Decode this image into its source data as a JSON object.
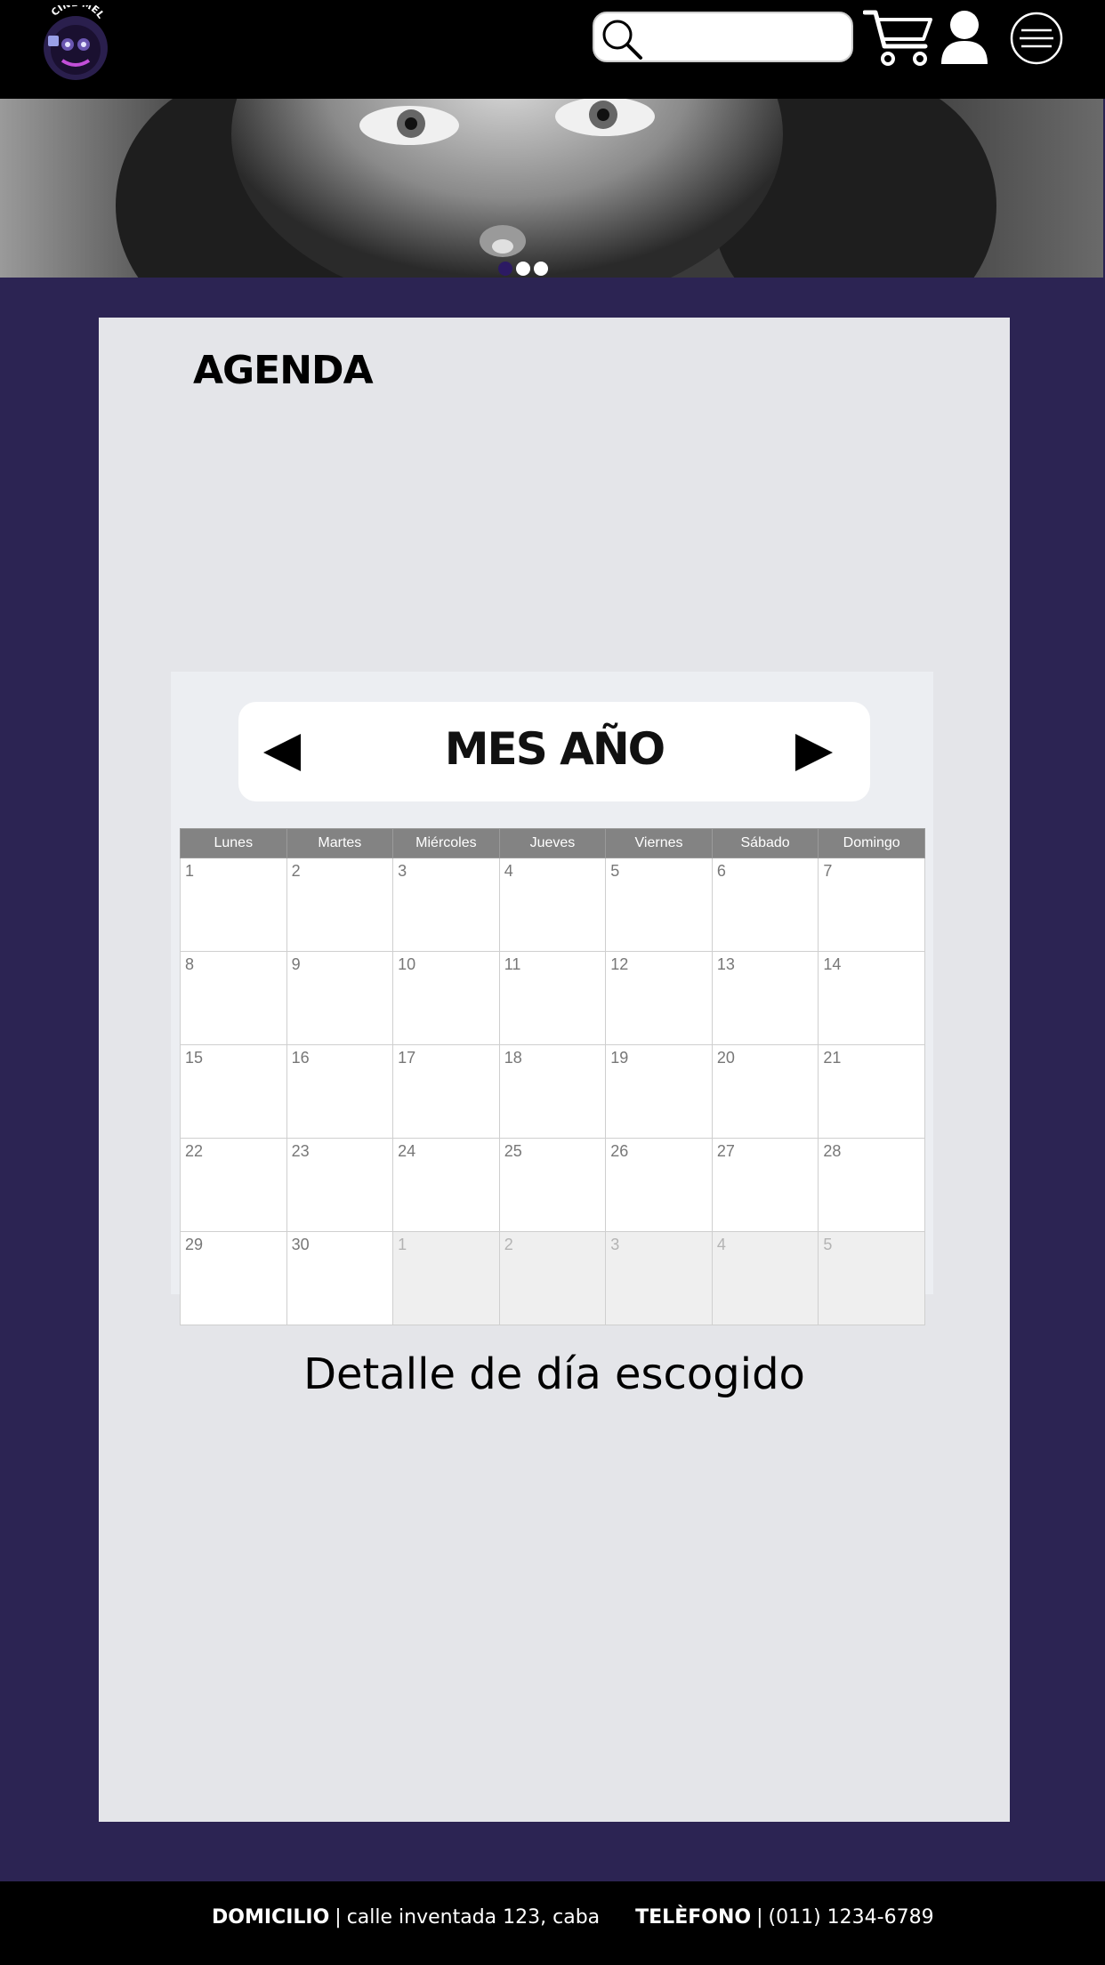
{
  "header": {
    "logo_text": "CINE MELIES",
    "search_placeholder": "",
    "icons": [
      "search-icon",
      "cart-icon",
      "user-icon",
      "menu-icon"
    ]
  },
  "hero": {
    "slides": 3,
    "active_slide": 1
  },
  "agenda": {
    "title": "AGENDA",
    "calendar": {
      "month_label": "MES AÑO",
      "weekdays": [
        "Lunes",
        "Martes",
        "Miércoles",
        "Jueves",
        "Viernes",
        "Sábado",
        "Domingo"
      ],
      "weeks": [
        [
          "1",
          "2",
          "3",
          "4",
          "5",
          "6",
          "7"
        ],
        [
          "8",
          "9",
          "10",
          "11",
          "12",
          "13",
          "14"
        ],
        [
          "15",
          "16",
          "17",
          "18",
          "19",
          "20",
          "21"
        ],
        [
          "22",
          "23",
          "24",
          "25",
          "26",
          "27",
          "28"
        ],
        [
          "29",
          "30",
          "1",
          "2",
          "3",
          "4",
          "5"
        ]
      ],
      "next_month_days_in_last_week": 5
    },
    "detail_text": "Detalle de día escogido"
  },
  "footer": {
    "address_label": "DOMICILIO",
    "address_value": "calle inventada 123, caba",
    "phone_label": "TELÈFONO",
    "phone_value": "(011) 1234-6789",
    "separator": "|"
  },
  "colors": {
    "background": "#2c2453",
    "panel": "#e4e5e9",
    "header": "#000000",
    "accent": "#2c1a63"
  }
}
